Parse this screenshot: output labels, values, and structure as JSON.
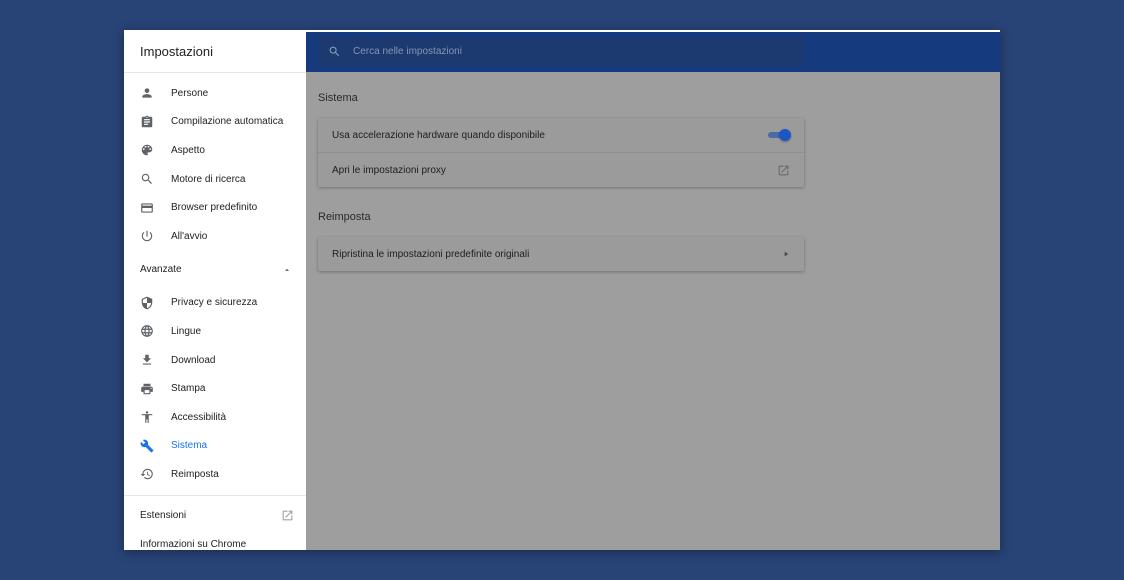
{
  "drawer": {
    "title": "Impostazioni",
    "items": [
      {
        "label": "Persone",
        "icon": "person-icon"
      },
      {
        "label": "Compilazione automatica",
        "icon": "clipboard-icon"
      },
      {
        "label": "Aspetto",
        "icon": "palette-icon"
      },
      {
        "label": "Motore di ricerca",
        "icon": "search-icon"
      },
      {
        "label": "Browser predefinito",
        "icon": "browser-icon"
      },
      {
        "label": "All'avvio",
        "icon": "power-icon"
      }
    ],
    "advanced_label": "Avanzate",
    "advanced_items": [
      {
        "label": "Privacy e sicurezza",
        "icon": "shield-icon"
      },
      {
        "label": "Lingue",
        "icon": "globe-icon"
      },
      {
        "label": "Download",
        "icon": "download-icon"
      },
      {
        "label": "Stampa",
        "icon": "printer-icon"
      },
      {
        "label": "Accessibilità",
        "icon": "accessibility-icon"
      },
      {
        "label": "Sistema",
        "icon": "wrench-icon",
        "active": true
      },
      {
        "label": "Reimposta",
        "icon": "history-icon"
      }
    ],
    "extensions_label": "Estensioni",
    "about_label": "Informazioni su Chrome"
  },
  "search": {
    "placeholder": "Cerca nelle impostazioni"
  },
  "main": {
    "system_title": "Sistema",
    "hardware_accel_label": "Usa accelerazione hardware quando disponibile",
    "hardware_accel_enabled": true,
    "proxy_label": "Apri le impostazioni proxy",
    "reset_title": "Reimposta",
    "restore_label": "Ripristina le impostazioni predefinite originali"
  },
  "colors": {
    "background": "#284376",
    "topbar": "#163a7e",
    "accent": "#1a73e8",
    "scrim": "#9e9e9e"
  }
}
